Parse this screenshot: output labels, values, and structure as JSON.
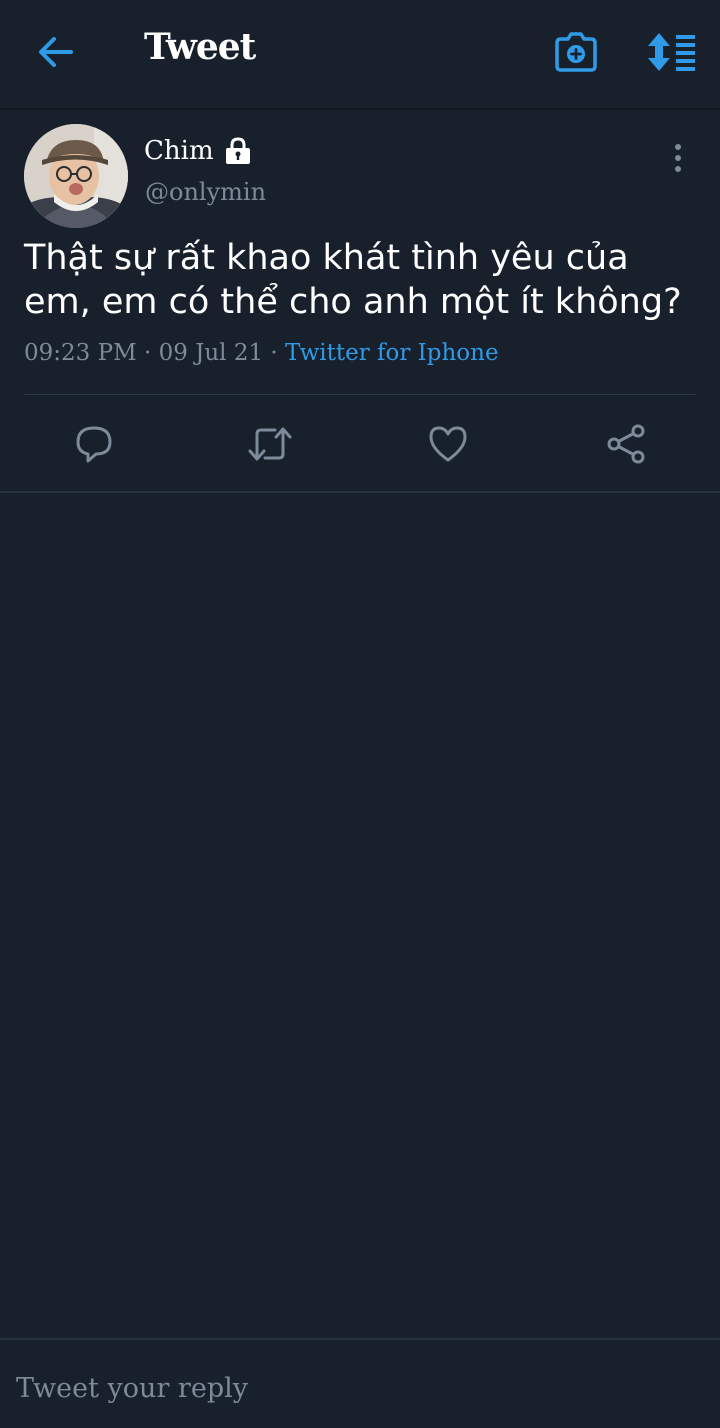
{
  "header": {
    "title": "Tweet",
    "back_icon": "arrow-left-icon",
    "camera_icon": "camera-add-icon",
    "sort_icon": "sort-list-icon"
  },
  "tweet": {
    "display_name": "Chim",
    "handle": "@onlymin",
    "protected_icon": "lock-icon",
    "text": "Thật sự rất khao khát tình yêu của em, em có thể cho anh một ít không?",
    "time": "09:23 PM",
    "separator": "·",
    "date": "09 Jul 21",
    "source": "Twitter for Iphone"
  },
  "actions": {
    "reply_icon": "reply-icon",
    "retweet_icon": "retweet-icon",
    "like_icon": "heart-icon",
    "share_icon": "share-icon"
  },
  "reply": {
    "placeholder": "Tweet your reply",
    "value": ""
  },
  "colors": {
    "background": "#17202b",
    "accent": "#2f9be8",
    "muted": "#7c8a99",
    "text": "#ffffff"
  }
}
